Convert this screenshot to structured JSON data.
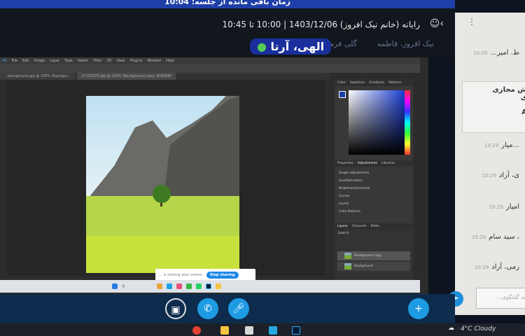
{
  "timer": "زمان باقی مانده از جلسه: 10:04",
  "header": {
    "meeting": "رایانه (خانم نیک افروز) 1403/12/06 | 10:00 تا 10:45",
    "participants": [
      "نیک افروز، فاطمه",
      "گلی فرمی، آراد"
    ],
    "active_speaker": "الهی، آرتا"
  },
  "photoshop": {
    "menu": [
      "Ps",
      "File",
      "Edit",
      "Image",
      "Layer",
      "Type",
      "Select",
      "Filter",
      "3D",
      "View",
      "Plugins",
      "Window",
      "Help"
    ],
    "doc_tabs": [
      "...background.jpg @ 100% (Backgro...",
      "27102370.jpg @ 100% (Background copy, RGB/8#)"
    ],
    "color_tabs": [
      "Color",
      "Swatches",
      "Gradients",
      "Patterns"
    ],
    "prop_tabs": [
      "Properties",
      "Adjustments",
      "Libraries"
    ],
    "adj_header": "Single adjustments",
    "adjustments": [
      "Hue/Saturation",
      "Brightness/Contrast",
      "Curves",
      "Levels",
      "Color Balance"
    ],
    "layer_tabs": [
      "Layers",
      "Channels",
      "Paths"
    ],
    "layers": [
      "Background copy",
      "Background"
    ],
    "search": "Search"
  },
  "share_banner": {
    "text": "... is sharing your screen",
    "stop": "Stop sharing"
  },
  "chat": {
    "messages": [
      {
        "name": "ط. امیر...",
        "time": "10:28"
      },
      {
        "name": "...میار",
        "time": "10:29"
      },
      {
        "name": "ی، آراد",
        "time": "10:29"
      },
      {
        "name": "امیار",
        "time": "10:29"
      },
      {
        "name": "، سید سام",
        "time": "10:29"
      },
      {
        "name": "رمی، آراد",
        "time": "10:29"
      }
    ],
    "box": [
      "ش مجازی",
      "ی",
      "A"
    ],
    "placeholder": "به گفتگوی..."
  },
  "taskbar": {
    "weather": "4°C Cloudy"
  },
  "colors": {
    "accent": "#1d9be3",
    "topbar": "#1f3fa8",
    "controls": "#0e2c4d"
  }
}
